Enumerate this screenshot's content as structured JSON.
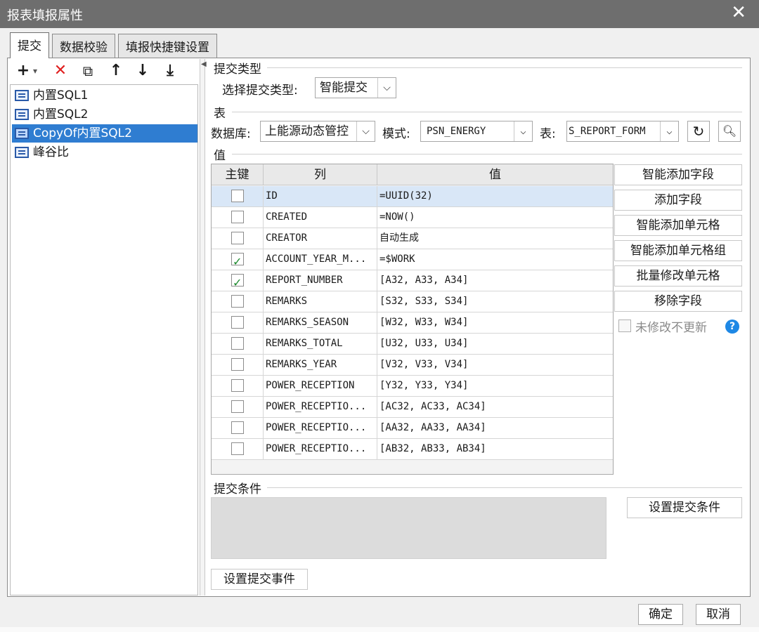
{
  "window": {
    "title": "报表填报属性",
    "close_glyph": "✕"
  },
  "tabs": [
    {
      "label": "提交",
      "active": true
    },
    {
      "label": "数据校验",
      "active": false
    },
    {
      "label": "填报快捷键设置",
      "active": false
    }
  ],
  "toolbar": {
    "add": "+",
    "add_dropdown": "▾",
    "delete": "✕",
    "copy": "⧉",
    "up": "↑",
    "down": "↓",
    "bottom": "⤓"
  },
  "tree": {
    "items": [
      {
        "label": "内置SQL1",
        "selected": false
      },
      {
        "label": "内置SQL2",
        "selected": false
      },
      {
        "label": "CopyOf内置SQL2",
        "selected": true
      },
      {
        "label": "峰谷比",
        "selected": false
      }
    ]
  },
  "submit_type": {
    "section_label": "提交类型",
    "select_label": "选择提交类型:",
    "value": "智能提交"
  },
  "table_section": {
    "section_label": "表",
    "db_label": "数据库:",
    "db_value": "上能源动态管控",
    "schema_label": "模式:",
    "schema_value": "PSN_ENERGY",
    "table_label": "表:",
    "table_value": "S_REPORT_FORM"
  },
  "value_section": {
    "section_label": "值",
    "columns": [
      "主键",
      "列",
      "值"
    ],
    "rows": [
      {
        "key": false,
        "col": "ID",
        "val": "=UUID(32)",
        "selected": true
      },
      {
        "key": false,
        "col": "CREATED",
        "val": "=NOW()",
        "selected": false
      },
      {
        "key": false,
        "col": "CREATOR",
        "val": "自动生成",
        "selected": false
      },
      {
        "key": true,
        "col": "ACCOUNT_YEAR_M...",
        "val": "=$WORK",
        "selected": false
      },
      {
        "key": true,
        "col": "REPORT_NUMBER",
        "val": "[A32, A33, A34]",
        "selected": false
      },
      {
        "key": false,
        "col": "REMARKS",
        "val": "[S32, S33, S34]",
        "selected": false
      },
      {
        "key": false,
        "col": "REMARKS_SEASON",
        "val": "[W32, W33, W34]",
        "selected": false
      },
      {
        "key": false,
        "col": "REMARKS_TOTAL",
        "val": "[U32, U33, U34]",
        "selected": false
      },
      {
        "key": false,
        "col": "REMARKS_YEAR",
        "val": "[V32, V33, V34]",
        "selected": false
      },
      {
        "key": false,
        "col": "POWER_RECEPTION",
        "val": "[Y32, Y33, Y34]",
        "selected": false
      },
      {
        "key": false,
        "col": "POWER_RECEPTIO...",
        "val": "[AC32, AC33, AC34]",
        "selected": false
      },
      {
        "key": false,
        "col": "POWER_RECEPTIO...",
        "val": "[AA32, AA33, AA34]",
        "selected": false
      },
      {
        "key": false,
        "col": "POWER_RECEPTIO...",
        "val": "[AB32, AB33, AB34]",
        "selected": false
      }
    ]
  },
  "side_buttons": {
    "smart_add_field": "智能添加字段",
    "add_field": "添加字段",
    "smart_add_cell": "智能添加单元格",
    "smart_add_cell_group": "智能添加单元格组",
    "batch_modify_cell": "批量修改单元格",
    "remove_field": "移除字段",
    "no_update_unmodified": "未修改不更新",
    "help": "?"
  },
  "condition": {
    "section_label": "提交条件",
    "set_button": "设置提交条件"
  },
  "event_button": "设置提交事件",
  "footer": {
    "ok": "确定",
    "cancel": "取消"
  }
}
